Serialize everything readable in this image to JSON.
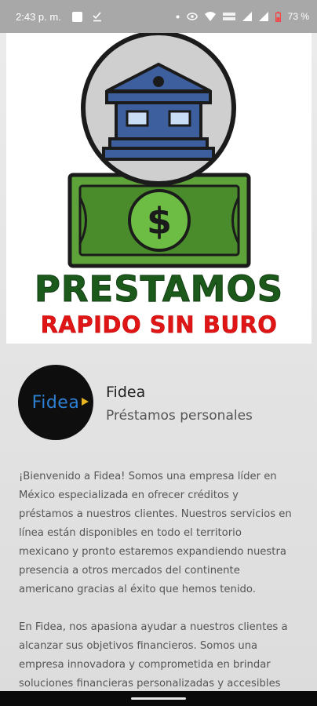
{
  "status_bar": {
    "time": "2:43 p. m.",
    "battery_percent": "73 %",
    "icons": [
      "notification-square-icon",
      "download-check-icon",
      "dot-icon",
      "eye-icon",
      "wifi-icon",
      "volte-icon",
      "signal-icon",
      "signal-icon-2",
      "battery-icon"
    ]
  },
  "banner": {
    "title": "PRESTAMOS",
    "subtitle": "RAPIDO SIN BURO",
    "colors": {
      "title": "#1c5a1c",
      "subtitle": "#e01616",
      "bank": "#3e5f9e",
      "money": "#5ea33a"
    },
    "icons": [
      "bank-icon",
      "dollar-bill-icon"
    ]
  },
  "app": {
    "logo_text": "Fidea",
    "name": "Fidea",
    "category": "Préstamos personales"
  },
  "description": {
    "paragraphs": [
      "¡Bienvenido a Fidea! Somos una empresa líder en México especializada en ofrecer créditos y préstamos a nuestros clientes. Nuestros servicios en línea están disponibles en todo el territorio mexicano y pronto estaremos expandiendo nuestra presencia a otros mercados del continente americano gracias al éxito que hemos tenido.",
      "En Fidea, nos apasiona ayudar a nuestros clientes a alcanzar sus objetivos financieros. Somos una empresa innovadora y comprometida en brindar soluciones financieras personalizadas y accesibles"
    ]
  }
}
